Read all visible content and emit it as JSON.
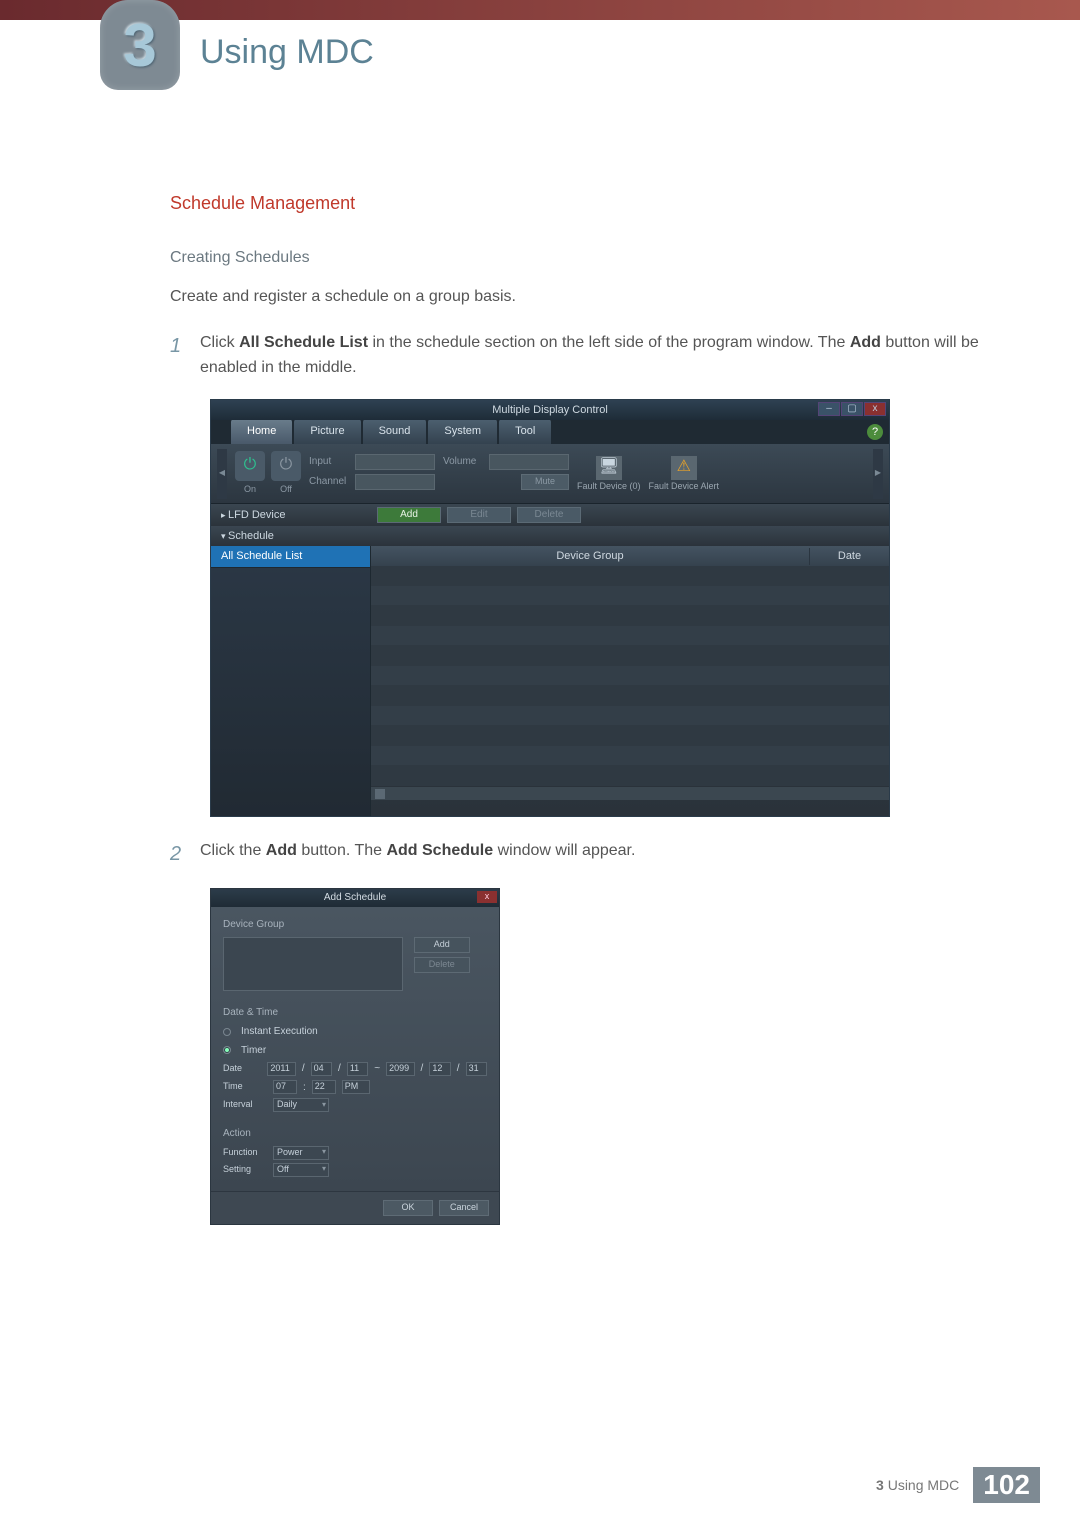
{
  "chapter": {
    "number": "3",
    "title": "Using MDC"
  },
  "section": {
    "title": "Schedule Management",
    "subtitle": "Creating Schedules",
    "intro": "Create and register a schedule on a group basis."
  },
  "steps": {
    "s1": {
      "num": "1",
      "pre": "Click ",
      "b1": "All Schedule List",
      "mid": " in the schedule section on the left side of the program window. The ",
      "b2": "Add",
      "post": " button will be enabled in the middle."
    },
    "s2": {
      "num": "2",
      "pre": "Click the ",
      "b1": "Add",
      "mid": " button. The ",
      "b2": "Add Schedule",
      "post": " window will appear."
    }
  },
  "mdc": {
    "title": "Multiple Display Control",
    "win": {
      "min": "–",
      "max": "▢",
      "close": "x"
    },
    "tabs": [
      "Home",
      "Picture",
      "Sound",
      "System",
      "Tool"
    ],
    "help": "?",
    "power": {
      "on": "On",
      "off": "Off"
    },
    "ribbon": {
      "input_label": "Input",
      "channel_label": "Channel",
      "volume_label": "Volume",
      "mute": "Mute",
      "fault0_label": "Fault Device\n(0)",
      "fault1_label": "Fault Device\nAlert"
    },
    "tree": {
      "lfd": "LFD Device",
      "schedule": "Schedule",
      "all": "All Schedule List"
    },
    "toolbar": {
      "add": "Add",
      "edit": "Edit",
      "delete": "Delete"
    },
    "grid": {
      "col1": "Device Group",
      "col2": "Date"
    }
  },
  "dlg": {
    "title": "Add Schedule",
    "close": "x",
    "device_group": "Device Group",
    "add": "Add",
    "delete": "Delete",
    "datetime": "Date & Time",
    "instant": "Instant Execution",
    "timer": "Timer",
    "date_label": "Date",
    "date_y1": "2011",
    "date_m1": "04",
    "date_d1": "11",
    "date_sep_tilde": "~",
    "date_y2": "2099",
    "date_m2": "12",
    "date_d2": "31",
    "time_label": "Time",
    "time_h": "07",
    "time_m": "22",
    "time_ap": "PM",
    "interval_label": "Interval",
    "interval_val": "Daily",
    "action": "Action",
    "function_label": "Function",
    "function_val": "Power",
    "setting_label": "Setting",
    "setting_val": "Off",
    "ok": "OK",
    "cancel": "Cancel"
  },
  "footer": {
    "chapter": "3",
    "title": "Using MDC",
    "page": "102"
  }
}
